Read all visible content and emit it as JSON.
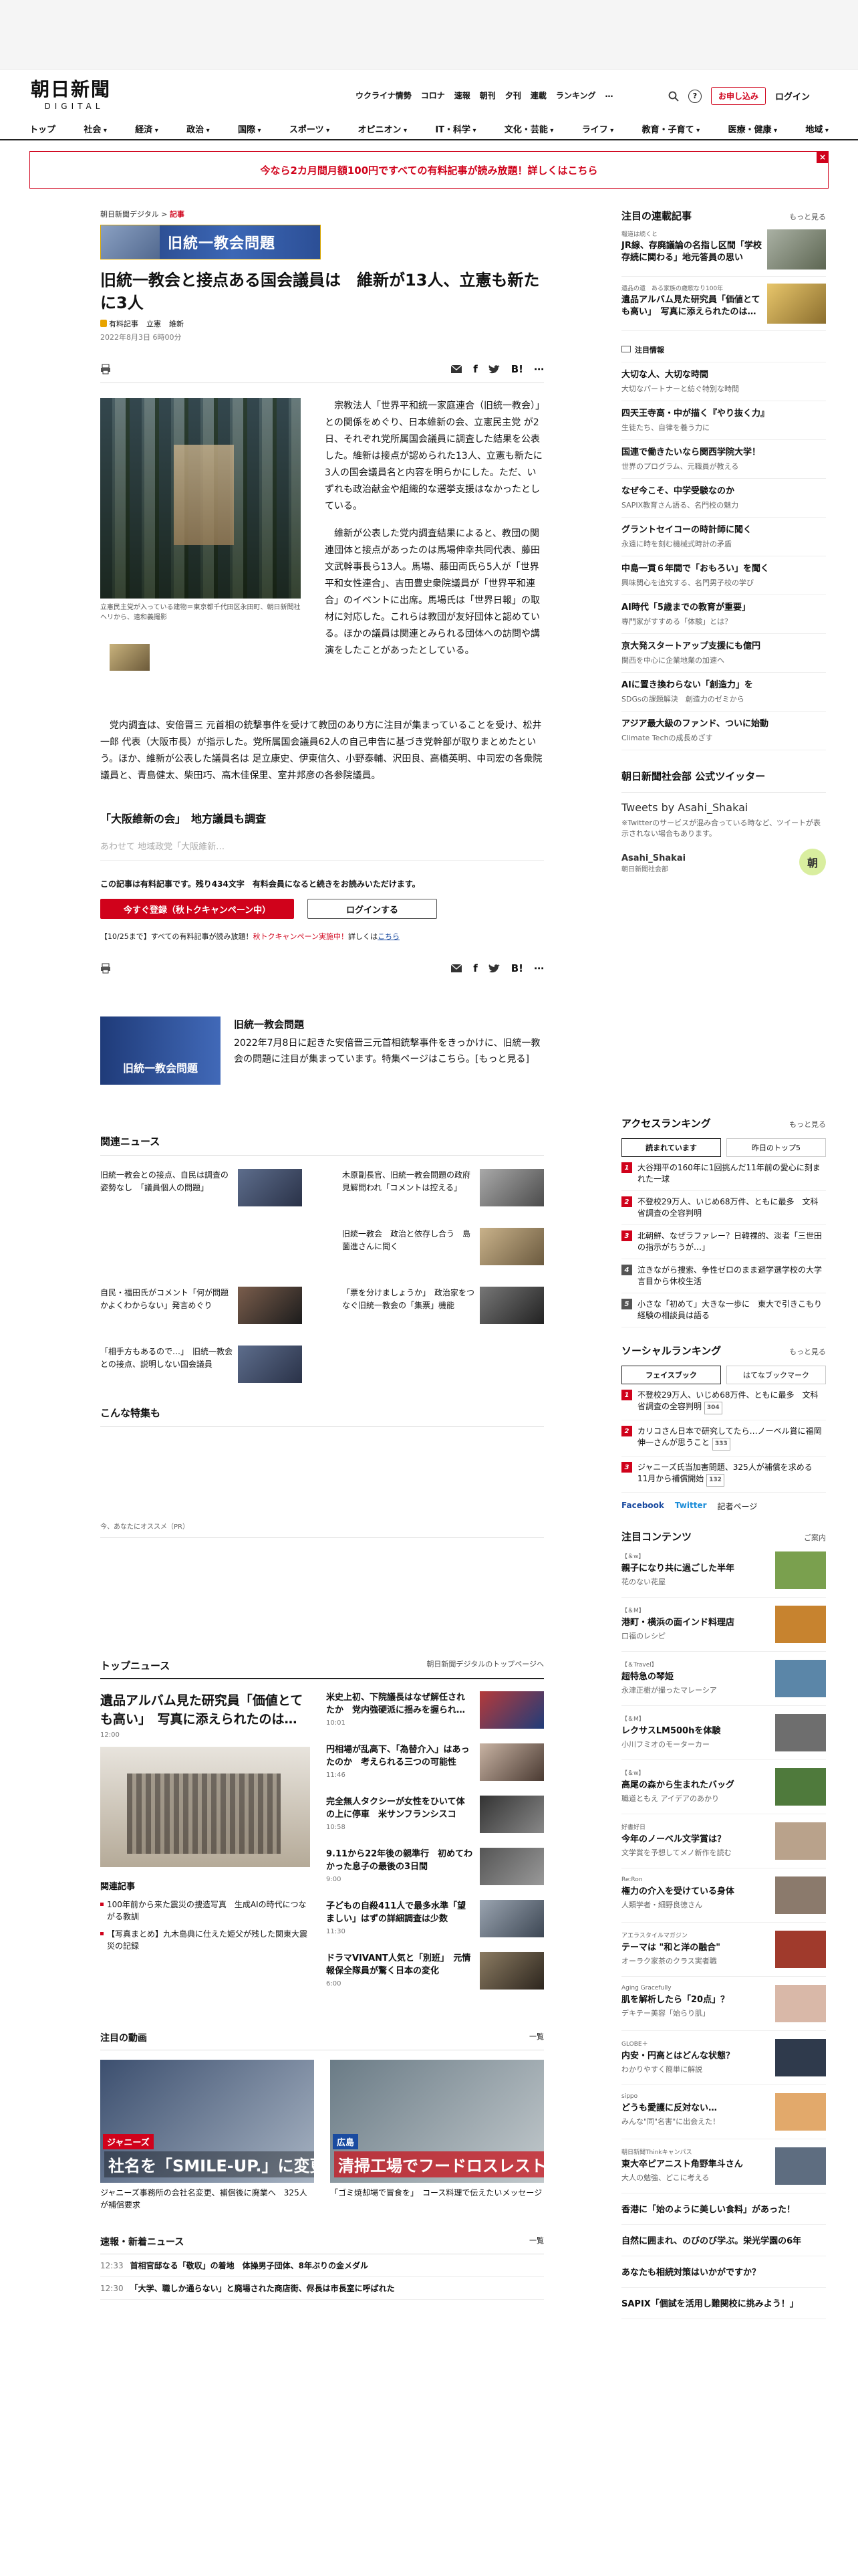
{
  "header": {
    "logo_jp": "朝日新聞",
    "logo_en": "DIGITAL",
    "gnav": [
      "ウクライナ情勢",
      "コロナ",
      "速報",
      "朝刊",
      "夕刊",
      "連載",
      "ランキング",
      "…"
    ],
    "help": "?",
    "subscribe": "お申し込み",
    "login": "ログイン"
  },
  "category_nav": [
    "トップ",
    "社会",
    "経済",
    "政治",
    "国際",
    "スポーツ",
    "オピニオン",
    "IT・科学",
    "文化・芸能",
    "ライフ",
    "教育・子育て",
    "医療・健康",
    "地域"
  ],
  "banner": {
    "text": "今なら2カ月間月額100円ですべての有料記事が読み放題！詳しくはこちら",
    "close": "×"
  },
  "article": {
    "crumb_site": "朝日新聞デジタル",
    "crumb_sep": ">",
    "crumb_section": "記事",
    "series": "旧統一教会問題",
    "title": "旧統一教会と接点ある国会議員は　維新が13人、立憲も新たに3人",
    "meta": [
      "有料記事",
      "立憲",
      "維新"
    ],
    "date": "2022年8月3日 6時00分",
    "list_label": "list",
    "para1": "宗教法人「世界平和統一家庭連合（旧統一教会）」との関係をめぐり、日本維新の会、立憲民主党 が2日、それぞれ党所属国会議員に調査した結果を公表した。維新は接点が認められた13人、立憲も新たに3人の国会議員名と内容を明らかにした。ただ、いずれも政治献金や組織的な選挙支援はなかったとしている。",
    "para1b": "維新が公表した党内調査結果によると、教団の関連団体と接点があったのは馬場伸幸共同代表、藤田文武幹事長ら13人。馬場、藤田両氏ら5人が「世界平和女性連合」、吉田豊史衆院議員が「世界平和連合」のイベントに出席。馬場氏は「世界日報」の取材に対応した。これらは教団が友好団体と認めている。ほかの議員は関連とみられる団体への訪問や講演をしたことがあったとしている。",
    "caption": "立憲民主党が入っている建物＝東京都千代田区永田町、朝日新聞社ヘリから、遠和義撮影",
    "para2": "党内調査は、安倍晋三 元首相の銃撃事件を受けて教団のあり方に注目が集まっていることを受け、松井一郎 代表（大阪市長）が指示した。党所属国会議員62人の自己申告に基づき党幹部が取りまとめたという。ほか、維新が公表した議員名は 足立康史、伊東信久、小野泰輔、沢田良、高橋英明、中司宏の各衆院議員と、青島健太、柴田巧、高木佳保里、室井邦彦の各参院議員。",
    "subhead": "「大阪維新の会」　地方議員も調査",
    "fade": "あわせて 地域政党「大阪維新…",
    "remain": "この記事は有料記事です。残り434文字　有料会員になると続きをお読みいただけます。",
    "cta_primary": "今すぐ登録（秋トクキャンペーン中）",
    "cta_login": "ログインする",
    "promo_a": "【10/25まで】すべての有料記事が読み放題！",
    "promo_b": "秋トクキャンペーン実施中！",
    "promo_c": "詳しくは",
    "promo_link": "こちら"
  },
  "feature": {
    "image_label": "旧統一教会問題",
    "title": "旧統一教会問題",
    "text": "2022年7月8日に起きた安倍晋三元首相銃撃事件をきっかけに、旧統一教会の問題に注目が集まっています。特集ページはこちら。[もっと見る]"
  },
  "related": {
    "heading": "関連ニュース",
    "items": [
      "旧統一教会との接点、自民は調査の姿勢なし　「議員個人の問題」",
      "木原副長官、旧統一教会問題の政府見解問われ「コメントは控える」",
      "",
      "旧統一教会　政治と依存し合う　島薗進さんに聞く",
      "自民・福田氏がコメント「何が問題かよくわからない」発言めぐり",
      "「票を分けましょうか」　政治家をつなぐ旧統一教会の「集票」機能",
      "「相手方もあるので…」　旧統一教会との接点、説明しない国会議員",
      ""
    ]
  },
  "special": {
    "heading": "こんな特集も",
    "pr": "今、あなたにオススメ（PR）"
  },
  "top_news": {
    "heading": "トップニュース",
    "link": "朝日新聞デジタルのトップページへ",
    "lead_title": "遺品アルバム見た研究員「価値とても高い」　写真に添えられたのは…",
    "lead_time": "12:00",
    "related_label": "関連記事",
    "related": [
      "100年前から来た震災の捜造写真　生成AIの時代につながる教訓",
      "【写真まとめ】九木島典に仕えた姫父が残した関東大震災の記録"
    ],
    "items": [
      {
        "t": "米史上初、下院議長はなぜ解任されたか　党内強硬派に揺みを握られ…",
        "tm": "10:01"
      },
      {
        "t": "円相場が乱高下、「為替介入」はあったのか　考えられる三つの可能性",
        "tm": "11:46"
      },
      {
        "t": "完全無人タクシーが女性をひいて体の上に停車　米サンフランシスコ",
        "tm": "10:58"
      },
      {
        "t": "9.11から22年後の親準行　初めてわかった息子の最後の3日間",
        "tm": "9:00"
      },
      {
        "t": "子どもの自殺411人で最多水準「望ましい」はずの詳細調査は少数",
        "tm": "11:30"
      },
      {
        "t": "ドラマVIVANT人気と「別班」　元情報保全隊員が驚く日本の変化",
        "tm": "6:00"
      }
    ]
  },
  "videos": {
    "heading": "注目の動画",
    "link": "一覧",
    "items": [
      {
        "tag": "ジャニーズ",
        "big": "社名を「SMILE-UP.」に変更",
        "cap": "ジャニーズ事務所の会社名変更、補償後に廃業へ　325人が補償要求"
      },
      {
        "tag": "広島",
        "big": "清掃工場でフードロスレストラン",
        "cap": "「ゴミ焼却場で冒食を」　コース料理で伝えたいメッセージ"
      }
    ]
  },
  "breaking": {
    "heading": "速報・新着ニュース",
    "link": "一覧",
    "rows": [
      {
        "t": "12:33",
        "x": "首相官邸なる「敬収」の着地　体操男子団体、8年ぶりの金メダル"
      },
      {
        "t": "12:30",
        "x": "「大学、職しか通らない」と廃場された商店街、侭長は市長室に呼ばれた"
      }
    ]
  },
  "sidebar": {
    "series_heading": "注目の連載記事",
    "more": "もっと見る",
    "series": [
      {
        "k": "報道は続くと",
        "t": "JR線、存廃議論の名指し区間「学校存続に関わる」地元答員の思い"
      },
      {
        "k": "遺品の遺　ある家族の歳歌なり100年",
        "t": "遺品アルバム見た研究員「価値とても高い」　写真に添えられたのは…"
      }
    ],
    "ad_heading": "注目情報",
    "ads": [
      {
        "t": "大切な人、大切な時間",
        "s": "大切なパートナーと紡ぐ特別な時間"
      },
      {
        "t": "四天王寺高・中が描く『やり抜く力』",
        "s": "生徒たち、自律を養う力に"
      },
      {
        "t": "国連で働きたいなら関西学院大学！",
        "s": "世界のプログラム、元職員が教える"
      },
      {
        "t": "なぜ今こそ、中学受験なのか",
        "s": "SAPIX教育さん語る、名門校の魅力"
      },
      {
        "t": "グラントセイコーの時計師に聞く",
        "s": "永遠に時を刻む機械式時計の矛盾"
      },
      {
        "t": "中島一貫６年間で「おもろい」を聞く",
        "s": "興味関心を追究する、名門男子校の学び"
      },
      {
        "t": "AI時代「5歳までの教育が重要」",
        "s": "専門家がすすめる「体験」とは？"
      },
      {
        "t": "京大発スタートアップ支援にも億円",
        "s": "関西を中心に企業地業の加速へ"
      },
      {
        "t": "AIに置き換わらない「創造力」を",
        "s": "SDGsの課題解決　創造力のゼミから"
      },
      {
        "t": "アジア最大級のファンド、ついに始動",
        "s": "Climate Techの成長めざす"
      }
    ],
    "twitter_heading": "朝日新聞社会部 公式ツイッター",
    "tweets_by": "Tweets by Asahi_Shakai",
    "tw_note": "※Twitterのサービスが混み合っている時など、ツイートが表示されない場合もあります。",
    "tw_name": "Asahi_Shakai",
    "tw_sub": "朝日新聞社会部",
    "tw_avatar": "朝",
    "ranking_heading": "アクセスランキング",
    "rank_tabs": [
      "読まれています",
      "昨日のトップ5"
    ],
    "ranking": [
      "大谷翔平の160年に1回挑んだ11年前の愛心に刻まれた一球",
      "不登校29万人、いじめ68万件、ともに最多　文科省調査の全容判明",
      "北朝鮮、なぜラファレー？日韓裸的、淡者「三世田の指示がちうが…」",
      "泣きながら捜索、争性ゼロのまま避学選学校の大学言目から休校生活",
      "小さな「初めて」大きな一歩に　東大で引きこもり経験の相談員は語る"
    ],
    "social_heading": "ソーシャルランキング",
    "social_tabs": [
      "フェイスブック",
      "はてなブックマーク"
    ],
    "social": [
      {
        "t": "不登校29万人、いじめ68万件、ともに最多　文科省調査の全容判明",
        "c": "304"
      },
      {
        "t": "カリコさん日本で研究してたら…ノーベル賞に福岡伸一さんが思うこと",
        "c": "333"
      },
      {
        "t": "ジャニーズ氏当加害問題、325人が補償を求める　11月から補償開始",
        "c": "132"
      }
    ],
    "share_fb": "Facebook",
    "share_tw": "Twitter",
    "share_more": "記者ページ",
    "contents_heading": "注目コンテンツ",
    "contents_more": "ご案内",
    "contents": [
      {
        "k": "【＆w】",
        "t": "親子になり共に過ごした半年",
        "s": "花のない花屋"
      },
      {
        "k": "【＆M】",
        "t": "港町・横浜の面インド料理店",
        "s": "口福のレシピ"
      },
      {
        "k": "【＆Travel】",
        "t": "超特急の琴姫",
        "s": "永津正樹が撮ったマレーシア"
      },
      {
        "k": "【＆M】",
        "t": "レクサスLM500hを体験",
        "s": "小川フミオのモーターカー"
      },
      {
        "k": "【＆w】",
        "t": "高尾の森から生まれたバッグ",
        "s": "職道ともえ アイデアのあかり"
      },
      {
        "k": "好書好日",
        "t": "今年のノーベル文学賞は？",
        "s": "文学賞を予想してメノ新作を読む"
      },
      {
        "k": "Re:Ron",
        "t": "権力の介入を受けている身体",
        "s": "人類学者・細野良徳さん"
      },
      {
        "k": "アエラスタイルマガジン",
        "t": "テーマは \"和と洋の融合\"",
        "s": "オーラク家茶のクラス実者職"
      },
      {
        "k": "Aging Gracefully",
        "t": "肌を解析したら「20点」？",
        "s": "デキテー美容「始らり肌」"
      },
      {
        "k": "GLOBE＋",
        "t": "内安・円高とはどんな状態？",
        "s": "わかりやすく簡単に解説"
      },
      {
        "k": "sippo",
        "t": "どうも愛護に反対ない…",
        "s": "みんな\"同\"名害\"に出会えた！"
      },
      {
        "k": "朝日新聞Thinkキャンパス",
        "t": "東大卒ピアニスト角野隼斗さん",
        "s": "大人の勉強、どこに考える"
      }
    ],
    "tail": [
      "香港に「始のように美しい食料」があった！",
      "自然に囲まれ、のびのび学ぶ。栄光学園の6年",
      "あなたも相続対策はいかがですか？",
      "SAPIX「個試を活用し難関校に挑みよう！」"
    ]
  }
}
